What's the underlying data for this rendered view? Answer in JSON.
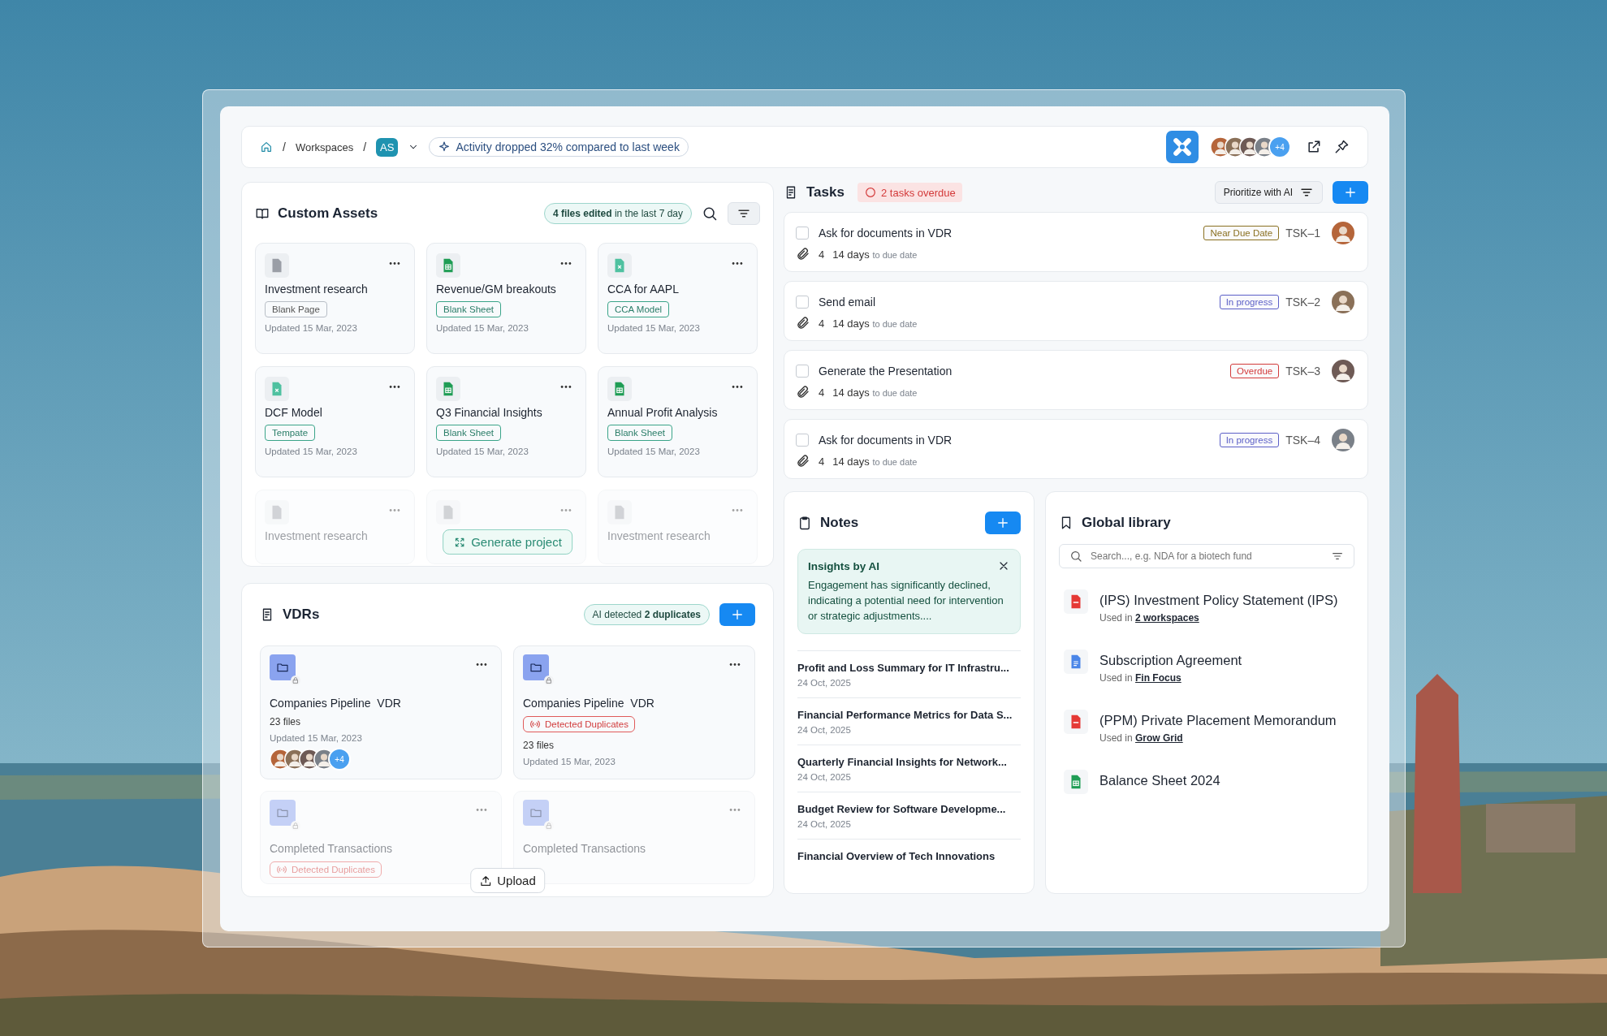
{
  "header": {
    "breadcrumb": [
      {
        "kind": "separator",
        "text": "/"
      },
      {
        "kind": "link",
        "text": "Workspaces"
      },
      {
        "kind": "separator",
        "text": "/"
      }
    ],
    "workspace": "AS",
    "activity": "Activity dropped 32% compared to last week",
    "members": [
      {
        "kind": "person"
      },
      {
        "kind": "person"
      },
      {
        "kind": "person"
      },
      {
        "kind": "person"
      }
    ],
    "members_more": "+4"
  },
  "custom_assets": {
    "title": "Custom Assets",
    "summary_count": "4 files edited",
    "summary_period": "in the last 7 day",
    "assets": [
      {
        "kind": "page",
        "name": "Investment research",
        "tag": "Blank Page",
        "updated": "Updated 15 Mar, 2023"
      },
      {
        "kind": "sheet",
        "name": "Revenue/GM breakouts",
        "tag": "Blank Sheet",
        "updated": "Updated 15 Mar, 2023"
      },
      {
        "kind": "model",
        "name": "CCA for AAPL",
        "tag": "CCA Model",
        "updated": "Updated 15 Mar, 2023"
      },
      {
        "kind": "model",
        "name": "DCF Model",
        "tag": "Tempate",
        "updated": "Updated 15 Mar, 2023"
      },
      {
        "kind": "sheet",
        "name": "Q3 Financial Insights",
        "tag": "Blank Sheet",
        "updated": "Updated 15 Mar, 2023"
      },
      {
        "kind": "sheet",
        "name": "Annual Profit Analysis",
        "tag": "Blank Sheet",
        "updated": "Updated 15 Mar, 2023"
      }
    ],
    "faded_assets": [
      {
        "kind": "page",
        "name": "Investment research"
      },
      {
        "kind": "page"
      },
      {
        "kind": "page",
        "name": "Investment research"
      }
    ],
    "generate_button": "Generate project"
  },
  "vdrs": {
    "title": "VDRs",
    "summary_label": "AI detected",
    "summary_count": "2 duplicates",
    "rooms": [
      {
        "name": "Companies Pipeline  VDR",
        "files": "23 files",
        "updated": "Updated 15 Mar, 2023",
        "members": [
          {
            "kind": "person"
          },
          {
            "kind": "person"
          },
          {
            "kind": "person"
          },
          {
            "kind": "person"
          }
        ],
        "members_more": "+4"
      },
      {
        "name": "Companies Pipeline  VDR",
        "flag": "Detected Duplicates",
        "files": "23 files",
        "updated": "Updated 15 Mar, 2023"
      },
      {
        "name": "Completed Transactions",
        "flag": "Detected Duplicates"
      },
      {
        "name": "Completed Transactions"
      }
    ],
    "upload_button": "Upload"
  },
  "tasks": {
    "title": "Tasks",
    "overdue": "2 tasks overdue",
    "prioritize": "Prioritize with AI",
    "items": [
      {
        "title": "Ask for documents in VDR",
        "checked": false,
        "status": "Near Due Date",
        "color": "#8a7020",
        "id": "TSK–1",
        "attachments": "4",
        "days": "14 days",
        "days_suffix": "to due date"
      },
      {
        "title": "Send email",
        "checked": false,
        "status": "In progress",
        "color": "#5b5fc7",
        "id": "TSK–2",
        "attachments": "4",
        "days": "14 days",
        "days_suffix": "to due date"
      },
      {
        "title": "Generate the Presentation",
        "checked": false,
        "status": "Overdue",
        "color": "#d33a3a",
        "id": "TSK–3",
        "attachments": "4",
        "days": "14 days",
        "days_suffix": "to due date"
      },
      {
        "title": "Ask for documents in VDR",
        "checked": false,
        "status": "In progress",
        "color": "#5b5fc7",
        "id": "TSK–4",
        "attachments": "4",
        "days": "14 days",
        "days_suffix": "to due date"
      }
    ]
  },
  "notes": {
    "title": "Notes",
    "insight_title": "Insights by AI",
    "insight_text": "Engagement has significantly declined, indicating a potential need for intervention or strategic adjustments....",
    "items": [
      {
        "title": "Profit and Loss Summary for IT Infrastru...",
        "date": "24 Oct, 2025"
      },
      {
        "title": "Financial Performance Metrics for Data S...",
        "date": "24 Oct, 2025"
      },
      {
        "title": "Quarterly Financial Insights for Network...",
        "date": "24 Oct, 2025"
      },
      {
        "title": "Budget Review for Software Developme...",
        "date": "24 Oct, 2025"
      },
      {
        "title": "Financial Overview of Tech Innovations"
      }
    ]
  },
  "library": {
    "title": "Global library",
    "placeholder": "Search..., e.g. NDA for a biotech fund",
    "items": [
      {
        "kind": "pdf",
        "name": "(IPS) Investment Policy Statement (IPS)",
        "used_label": "Used in",
        "used_in": "2 workspaces"
      },
      {
        "kind": "doc",
        "name": "Subscription Agreement",
        "used_label": "Used in",
        "used_in": "Fin Focus"
      },
      {
        "kind": "pdf",
        "name": "(PPM) Private Placement Memorandum",
        "used_label": "Used in",
        "used_in": "Grow Grid"
      },
      {
        "kind": "sheet",
        "name": "Balance Sheet 2024"
      }
    ]
  }
}
